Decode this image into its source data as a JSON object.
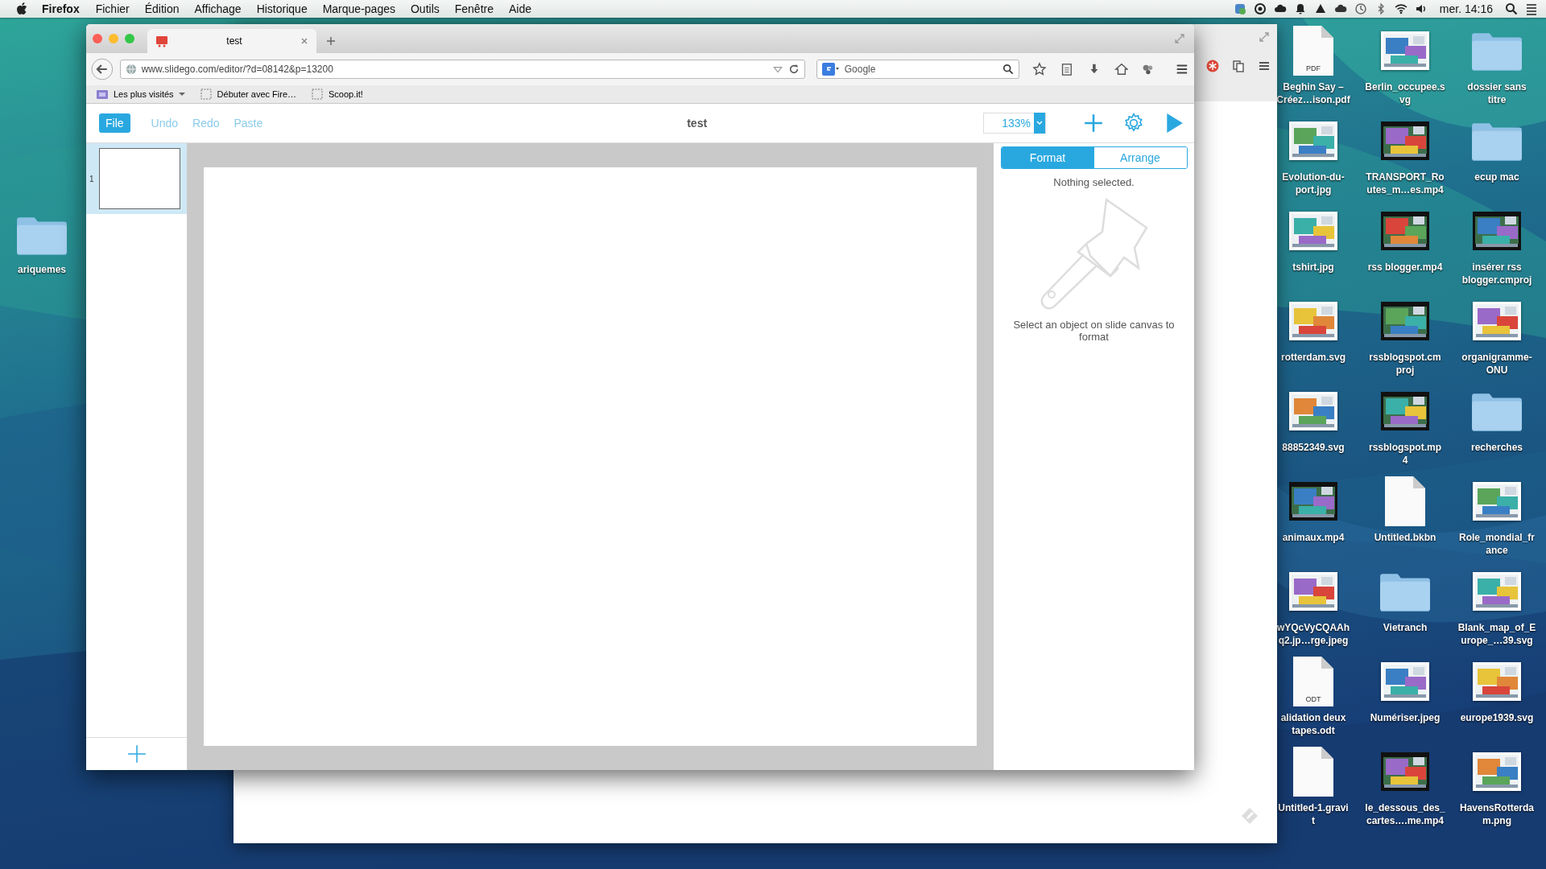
{
  "menubar": {
    "app": "Firefox",
    "menus": [
      "Fichier",
      "Édition",
      "Affichage",
      "Historique",
      "Marque-pages",
      "Outils",
      "Fenêtre",
      "Aide"
    ],
    "clock": "mer. 14:16"
  },
  "browser": {
    "tab": {
      "title": "test"
    },
    "url": "www.slidego.com/editor/?d=08142&p=13200",
    "search": {
      "placeholder": "Google"
    },
    "bookmarks": [
      {
        "label": "Les plus visités",
        "kind": "folder"
      },
      {
        "label": "Débuter avec Fire…",
        "kind": "page"
      },
      {
        "label": "Scoop.it!",
        "kind": "page"
      }
    ]
  },
  "editor": {
    "toolbar": [
      {
        "label": "File",
        "disabled": false,
        "kind": "primary"
      },
      {
        "label": "Undo",
        "disabled": true,
        "kind": "plain"
      },
      {
        "label": "Redo",
        "disabled": true,
        "kind": "plain"
      },
      {
        "label": "Paste",
        "disabled": true,
        "kind": "plain"
      }
    ],
    "title": "test",
    "zoom": "133%",
    "slides": [
      {
        "number": "1",
        "selected": true
      }
    ],
    "panel_tabs": [
      {
        "label": "Format",
        "selected": true
      },
      {
        "label": "Arrange",
        "selected": false
      }
    ],
    "status": "Nothing selected.",
    "hint": "Select an object on slide canvas to format"
  },
  "desktop": {
    "left_items": [
      {
        "label": "ariquemes",
        "kind": "folder"
      }
    ],
    "items": [
      {
        "label": "Beghin Say –\nCréez…ison.pdf",
        "kind": "doc",
        "badge": "PDF"
      },
      {
        "label": "Berlin_occupee.s\nvg"
      },
      {
        "label": "dossier sans\ntitre",
        "kind": "folder"
      },
      {
        "label": "Evolution-du-\nport.jpg"
      },
      {
        "label": "TRANSPORT_Ro\nutes_m…es.mp4",
        "kind": "video"
      },
      {
        "label": "ecup mac",
        "kind": "folder"
      },
      {
        "label": "tshirt.jpg"
      },
      {
        "label": "rss blogger.mp4",
        "kind": "video"
      },
      {
        "label": "insérer rss\nblogger.cmproj",
        "kind": "video"
      },
      {
        "label": "rotterdam.svg"
      },
      {
        "label": "rssblogspot.cm\nproj",
        "kind": "video"
      },
      {
        "label": "organigramme-\nONU"
      },
      {
        "label": "88852349.svg"
      },
      {
        "label": "rssblogspot.mp\n4",
        "kind": "video"
      },
      {
        "label": "recherches",
        "kind": "folder"
      },
      {
        "label": "animaux.mp4",
        "kind": "video"
      },
      {
        "label": "Untitled.bkbn",
        "kind": "doc"
      },
      {
        "label": "Role_mondial_fr\nance"
      },
      {
        "label": "wYQcVyCQAAh\nq2.jp…rge.jpeg"
      },
      {
        "label": "Vietranch",
        "kind": "folder"
      },
      {
        "label": "Blank_map_of_E\nurope_…39.svg"
      },
      {
        "label": "alidation deux\ntapes.odt",
        "kind": "doc",
        "badge": "ODT"
      },
      {
        "label": "Numériser.jpeg"
      },
      {
        "label": "europe1939.svg"
      },
      {
        "label": "Untitled-1.gravi\nt",
        "kind": "doc"
      },
      {
        "label": "le_dessous_des_\ncartes….me.mp4",
        "kind": "video"
      },
      {
        "label": "HavensRotterda\nm.png"
      }
    ]
  }
}
